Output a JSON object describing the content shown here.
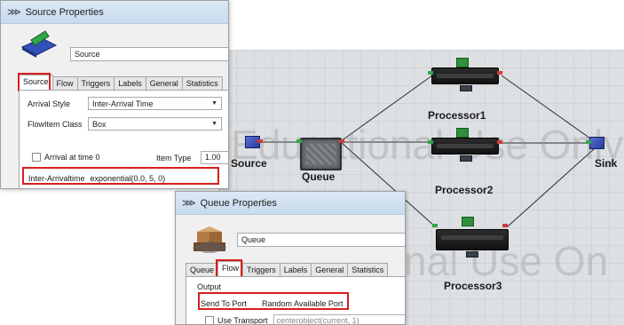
{
  "model": {
    "watermark_top": "Educational Use Only",
    "watermark_bottom": "nal Use On",
    "objects": {
      "source": "Source",
      "queue": "Queue",
      "processor1": "Processor1",
      "processor2": "Processor2",
      "processor3": "Processor3",
      "sink": "Sink"
    }
  },
  "source_dialog": {
    "title": "Source Properties",
    "name_value": "Source",
    "tabs": [
      "Source",
      "Flow",
      "Triggers",
      "Labels",
      "General",
      "Statistics"
    ],
    "active_tab": "Source",
    "arrival_style_label": "Arrival Style",
    "arrival_style_value": "Inter-Arrival Time",
    "flowitem_class_label": "FlowItem Class",
    "flowitem_class_value": "Box",
    "arrival_at_time0_label": "Arrival at time 0",
    "item_type_label": "Item Type",
    "item_type_value": "1.00",
    "interarrival_label": "Inter-Arrivaltime",
    "interarrival_value": "exponential(0.0, 5, 0)"
  },
  "queue_dialog": {
    "title": "Queue Properties",
    "name_value": "Queue",
    "tabs": [
      "Queue",
      "Flow",
      "Triggers",
      "Labels",
      "General",
      "Statistics"
    ],
    "active_tab": "Flow",
    "output_label": "Output",
    "send_to_port_label": "Send To Port",
    "send_to_port_value": "Random Available Port",
    "use_transport_label": "Use Transport",
    "use_transport_value": "centerobject(current, 1)"
  },
  "colors": {
    "highlight": "#d81e1e",
    "model_background": "#dde0e3",
    "titlebar": "#c8daee"
  }
}
